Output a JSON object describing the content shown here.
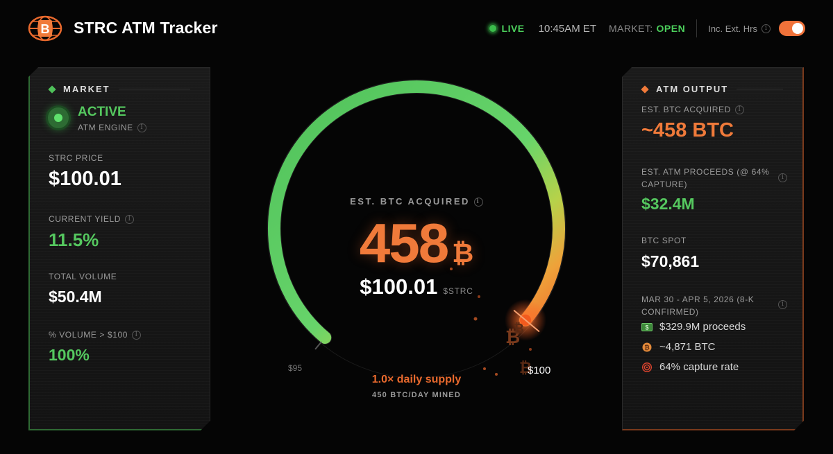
{
  "header": {
    "title": "STRC ATM Tracker",
    "live_label": "LIVE",
    "time": "10:45AM ET",
    "market_label": "MARKET:",
    "market_status": "OPEN",
    "ext_hours_label": "Inc. Ext. Hrs",
    "ext_hours_enabled": true
  },
  "market_panel": {
    "title": "MARKET",
    "status": "ACTIVE",
    "status_sub": "ATM ENGINE",
    "strc_price_label": "STRC PRICE",
    "strc_price": "$100.01",
    "yield_label": "CURRENT YIELD",
    "yield": "11.5%",
    "volume_label": "TOTAL VOLUME",
    "volume": "$50.4M",
    "pct_volume_label": "% VOLUME > $100",
    "pct_volume": "100%"
  },
  "gauge": {
    "label": "EST. BTC ACQUIRED",
    "value": "458",
    "unit_symbol": "₿",
    "price": "$100.01",
    "ticker": "$STRC",
    "min_label": "$95",
    "max_label": "$100",
    "level_fraction": 1.0,
    "supply_text": "1.0× daily supply",
    "mined_text": "450 BTC/DAY MINED"
  },
  "atm_panel": {
    "title": "ATM OUTPUT",
    "btc_acquired_label": "EST. BTC ACQUIRED",
    "btc_acquired": "~458 BTC",
    "proceeds_label": "EST. ATM PROCEEDS (@ 64% CAPTURE)",
    "proceeds": "$32.4M",
    "spot_label": "BTC SPOT",
    "spot": "$70,861",
    "period_label": "MAR 30 - APR 5, 2026 (8-K CONFIRMED)",
    "items": [
      {
        "icon": "cash-icon",
        "text": "$329.9M proceeds"
      },
      {
        "icon": "bitcoin-coin-icon",
        "text": "~4,871 BTC"
      },
      {
        "icon": "target-icon",
        "text": "64% capture rate"
      }
    ]
  },
  "colors": {
    "accent_orange": "#f07a3a",
    "accent_green": "#55c85f",
    "background": "#050505"
  }
}
